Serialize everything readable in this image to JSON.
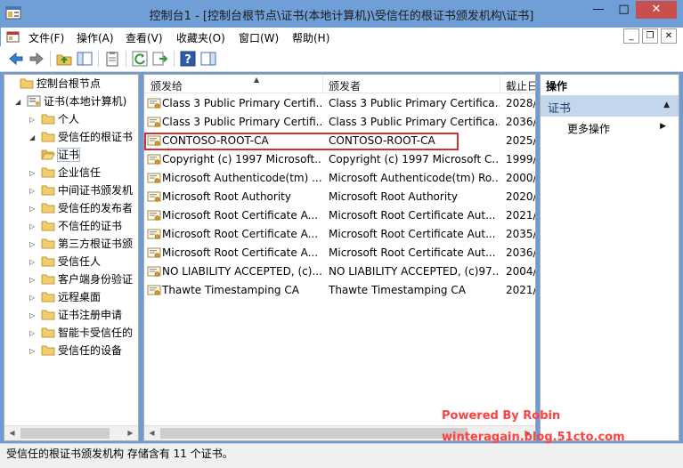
{
  "window": {
    "title": "控制台1 - [控制台根节点\\证书(本地计算机)\\受信任的根证书颁发机构\\证书]",
    "min_label": "—",
    "max_label": "□",
    "close_label": "✕"
  },
  "menu": {
    "items": [
      "文件(F)",
      "操作(A)",
      "查看(V)",
      "收藏夹(O)",
      "窗口(W)",
      "帮助(H)"
    ],
    "mdi_min": "_",
    "mdi_restore": "❐",
    "mdi_close": "✕"
  },
  "toolbar": {
    "icons": [
      "back-arrow-icon",
      "forward-arrow-icon",
      "up-folder-icon",
      "show-hide-tree-icon",
      "properties-icon",
      "refresh-icon",
      "export-list-icon",
      "help-icon",
      "show-hide-action-pane-icon"
    ]
  },
  "tree": {
    "items": [
      {
        "label": "控制台根节点",
        "toggle": "",
        "icon": "folder",
        "level": 0
      },
      {
        "label": "证书(本地计算机)",
        "toggle": "◢",
        "icon": "cert-store",
        "level": 1
      },
      {
        "label": "个人",
        "toggle": "▷",
        "icon": "folder",
        "level": 2
      },
      {
        "label": "受信任的根证书",
        "toggle": "◢",
        "icon": "folder",
        "level": 2
      },
      {
        "label": "证书",
        "toggle": "",
        "icon": "folder-open",
        "level": 3,
        "selected": true
      },
      {
        "label": "企业信任",
        "toggle": "▷",
        "icon": "folder",
        "level": 2
      },
      {
        "label": "中间证书颁发机",
        "toggle": "▷",
        "icon": "folder",
        "level": 2
      },
      {
        "label": "受信任的发布者",
        "toggle": "▷",
        "icon": "folder",
        "level": 2
      },
      {
        "label": "不信任的证书",
        "toggle": "▷",
        "icon": "folder",
        "level": 2
      },
      {
        "label": "第三方根证书颁",
        "toggle": "▷",
        "icon": "folder",
        "level": 2
      },
      {
        "label": "受信任人",
        "toggle": "▷",
        "icon": "folder",
        "level": 2
      },
      {
        "label": "客户端身份验证",
        "toggle": "▷",
        "icon": "folder",
        "level": 2
      },
      {
        "label": "远程桌面",
        "toggle": "▷",
        "icon": "folder",
        "level": 2
      },
      {
        "label": "证书注册申请",
        "toggle": "▷",
        "icon": "folder",
        "level": 2
      },
      {
        "label": "智能卡受信任的",
        "toggle": "▷",
        "icon": "folder",
        "level": 2
      },
      {
        "label": "受信任的设备",
        "toggle": "▷",
        "icon": "folder",
        "level": 2
      }
    ]
  },
  "list": {
    "columns": [
      "颁发给",
      "颁发者",
      "截止日"
    ],
    "rows": [
      {
        "issued_to": "Class 3 Public Primary Certifi...",
        "issued_by": "Class 3 Public Primary Certifica...",
        "expires": "2028/"
      },
      {
        "issued_to": "Class 3 Public Primary Certifi...",
        "issued_by": "Class 3 Public Primary Certifica...",
        "expires": "2036/"
      },
      {
        "issued_to": "CONTOSO-ROOT-CA",
        "issued_by": "CONTOSO-ROOT-CA",
        "expires": "2025/"
      },
      {
        "issued_to": "Copyright (c) 1997 Microsoft...",
        "issued_by": "Copyright (c) 1997 Microsoft C...",
        "expires": "1999/"
      },
      {
        "issued_to": "Microsoft Authenticode(tm) ...",
        "issued_by": "Microsoft Authenticode(tm) Ro...",
        "expires": "2000/"
      },
      {
        "issued_to": "Microsoft Root Authority",
        "issued_by": "Microsoft Root Authority",
        "expires": "2020/"
      },
      {
        "issued_to": "Microsoft Root Certificate A...",
        "issued_by": "Microsoft Root Certificate Aut...",
        "expires": "2021/"
      },
      {
        "issued_to": "Microsoft Root Certificate A...",
        "issued_by": "Microsoft Root Certificate Aut...",
        "expires": "2035/"
      },
      {
        "issued_to": "Microsoft Root Certificate A...",
        "issued_by": "Microsoft Root Certificate Aut...",
        "expires": "2036/"
      },
      {
        "issued_to": "NO LIABILITY ACCEPTED, (c)...",
        "issued_by": "NO LIABILITY ACCEPTED, (c)97...",
        "expires": "2004/"
      },
      {
        "issued_to": "Thawte Timestamping CA",
        "issued_by": "Thawte Timestamping CA",
        "expires": "2021/"
      }
    ]
  },
  "actions": {
    "header": "操作",
    "section": "证书",
    "more": "更多操作"
  },
  "status": {
    "text": "受信任的根证书颁发机构 存储含有 11 个证书。"
  },
  "watermark": {
    "line1": "Powered By Robin",
    "line2": "winteragain.blog.51cto.com"
  },
  "colors": {
    "title_bar": "#6f9fd6",
    "highlight_box": "#d03030",
    "action_section": "#c4d6ec",
    "watermark": "#ff4141"
  }
}
